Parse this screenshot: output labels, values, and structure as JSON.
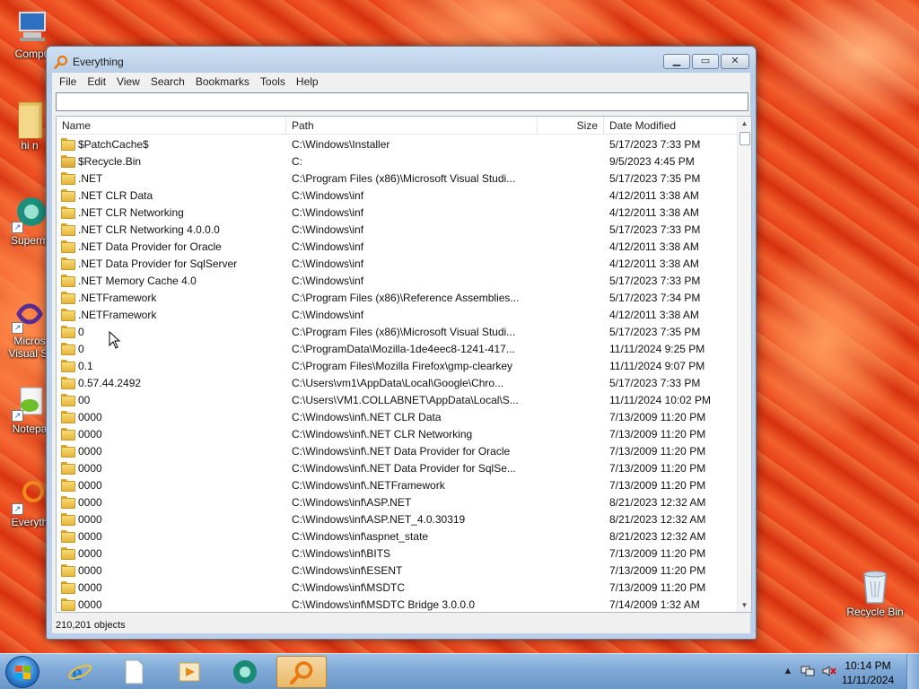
{
  "desktop": {
    "icons": [
      {
        "label": "Compu"
      },
      {
        "label": "hi n"
      },
      {
        "label": "Superm"
      },
      {
        "label": "Micros Visual St"
      },
      {
        "label": "Notepa"
      },
      {
        "label": "Everyth"
      },
      {
        "label": "Recycle Bin"
      }
    ]
  },
  "window": {
    "title": "Everything",
    "caption": {
      "minimize": "▁",
      "maximize": "▭",
      "close": "✕"
    }
  },
  "menu": [
    "File",
    "Edit",
    "View",
    "Search",
    "Bookmarks",
    "Tools",
    "Help"
  ],
  "search": {
    "value": ""
  },
  "columns": {
    "name": "Name",
    "path": "Path",
    "size": "Size",
    "date": "Date Modified"
  },
  "rows": [
    {
      "name": "$PatchCache$",
      "path": "C:\\Windows\\Installer",
      "size": "",
      "date": "5/17/2023 7:33 PM",
      "icon": "folder"
    },
    {
      "name": "$Recycle.Bin",
      "path": "C:",
      "size": "",
      "date": "9/5/2023 4:45 PM",
      "icon": "folder-locked"
    },
    {
      "name": ".NET",
      "path": "C:\\Program Files (x86)\\Microsoft Visual Studi...",
      "size": "",
      "date": "5/17/2023 7:35 PM",
      "icon": "folder"
    },
    {
      "name": ".NET CLR Data",
      "path": "C:\\Windows\\inf",
      "size": "",
      "date": "4/12/2011 3:38 AM",
      "icon": "folder"
    },
    {
      "name": ".NET CLR Networking",
      "path": "C:\\Windows\\inf",
      "size": "",
      "date": "4/12/2011 3:38 AM",
      "icon": "folder"
    },
    {
      "name": ".NET CLR Networking 4.0.0.0",
      "path": "C:\\Windows\\inf",
      "size": "",
      "date": "5/17/2023 7:33 PM",
      "icon": "folder"
    },
    {
      "name": ".NET Data Provider for Oracle",
      "path": "C:\\Windows\\inf",
      "size": "",
      "date": "4/12/2011 3:38 AM",
      "icon": "folder"
    },
    {
      "name": ".NET Data Provider for SqlServer",
      "path": "C:\\Windows\\inf",
      "size": "",
      "date": "4/12/2011 3:38 AM",
      "icon": "folder"
    },
    {
      "name": ".NET Memory Cache 4.0",
      "path": "C:\\Windows\\inf",
      "size": "",
      "date": "5/17/2023 7:33 PM",
      "icon": "folder"
    },
    {
      "name": ".NETFramework",
      "path": "C:\\Program Files (x86)\\Reference Assemblies...",
      "size": "",
      "date": "5/17/2023 7:34 PM",
      "icon": "folder"
    },
    {
      "name": ".NETFramework",
      "path": "C:\\Windows\\inf",
      "size": "",
      "date": "4/12/2011 3:38 AM",
      "icon": "folder"
    },
    {
      "name": "0",
      "path": "C:\\Program Files (x86)\\Microsoft Visual Studi...",
      "size": "",
      "date": "5/17/2023 7:35 PM",
      "icon": "folder"
    },
    {
      "name": "0",
      "path": "C:\\ProgramData\\Mozilla-1de4eec8-1241-417...",
      "size": "",
      "date": "11/11/2024 9:25 PM",
      "icon": "folder"
    },
    {
      "name": "0.1",
      "path": "C:\\Program Files\\Mozilla Firefox\\gmp-clearkey",
      "size": "",
      "date": "11/11/2024 9:07 PM",
      "icon": "folder"
    },
    {
      "name": "0.57.44.2492",
      "path": "C:\\Users\\vm1\\AppData\\Local\\Google\\Chro...",
      "size": "",
      "date": "5/17/2023 7:33 PM",
      "icon": "folder"
    },
    {
      "name": "00",
      "path": "C:\\Users\\VM1.COLLABNET\\AppData\\Local\\S...",
      "size": "",
      "date": "11/11/2024 10:02 PM",
      "icon": "folder"
    },
    {
      "name": "0000",
      "path": "C:\\Windows\\inf\\.NET CLR Data",
      "size": "",
      "date": "7/13/2009 11:20 PM",
      "icon": "folder"
    },
    {
      "name": "0000",
      "path": "C:\\Windows\\inf\\.NET CLR Networking",
      "size": "",
      "date": "7/13/2009 11:20 PM",
      "icon": "folder"
    },
    {
      "name": "0000",
      "path": "C:\\Windows\\inf\\.NET Data Provider for Oracle",
      "size": "",
      "date": "7/13/2009 11:20 PM",
      "icon": "folder"
    },
    {
      "name": "0000",
      "path": "C:\\Windows\\inf\\.NET Data Provider for SqlSe...",
      "size": "",
      "date": "7/13/2009 11:20 PM",
      "icon": "folder"
    },
    {
      "name": "0000",
      "path": "C:\\Windows\\inf\\.NETFramework",
      "size": "",
      "date": "7/13/2009 11:20 PM",
      "icon": "folder"
    },
    {
      "name": "0000",
      "path": "C:\\Windows\\inf\\ASP.NET",
      "size": "",
      "date": "8/21/2023 12:32 AM",
      "icon": "folder"
    },
    {
      "name": "0000",
      "path": "C:\\Windows\\inf\\ASP.NET_4.0.30319",
      "size": "",
      "date": "8/21/2023 12:32 AM",
      "icon": "folder"
    },
    {
      "name": "0000",
      "path": "C:\\Windows\\inf\\aspnet_state",
      "size": "",
      "date": "8/21/2023 12:32 AM",
      "icon": "folder"
    },
    {
      "name": "0000",
      "path": "C:\\Windows\\inf\\BITS",
      "size": "",
      "date": "7/13/2009 11:20 PM",
      "icon": "folder"
    },
    {
      "name": "0000",
      "path": "C:\\Windows\\inf\\ESENT",
      "size": "",
      "date": "7/13/2009 11:20 PM",
      "icon": "folder"
    },
    {
      "name": "0000",
      "path": "C:\\Windows\\inf\\MSDTC",
      "size": "",
      "date": "7/13/2009 11:20 PM",
      "icon": "folder"
    },
    {
      "name": "0000",
      "path": "C:\\Windows\\inf\\MSDTC Bridge 3.0.0.0",
      "size": "",
      "date": "7/14/2009 1:32 AM",
      "icon": "folder"
    }
  ],
  "status": {
    "text": "210,201 objects"
  },
  "taskbar": {
    "items": [
      {
        "name": "internet-explorer",
        "active": false
      },
      {
        "name": "notepad",
        "active": false
      },
      {
        "name": "media-player",
        "active": false
      },
      {
        "name": "supermium",
        "active": false
      },
      {
        "name": "everything",
        "active": true
      }
    ],
    "clock": {
      "time": "10:14 PM",
      "date": "11/11/2024"
    }
  }
}
